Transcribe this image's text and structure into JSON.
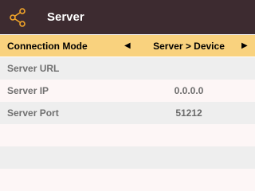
{
  "header": {
    "title": "Server",
    "icon": "share-icon",
    "accent": "#f4a629",
    "background": "#3d2b30"
  },
  "connection_mode": {
    "label": "Connection Mode",
    "value": "Server > Device",
    "prev_arrow": "◀",
    "next_arrow": "▶"
  },
  "settings": {
    "server_url": {
      "label": "Server URL",
      "value": ""
    },
    "server_ip": {
      "label": "Server IP",
      "value": "0.0.0.0"
    },
    "server_port": {
      "label": "Server Port",
      "value": "51212"
    }
  }
}
